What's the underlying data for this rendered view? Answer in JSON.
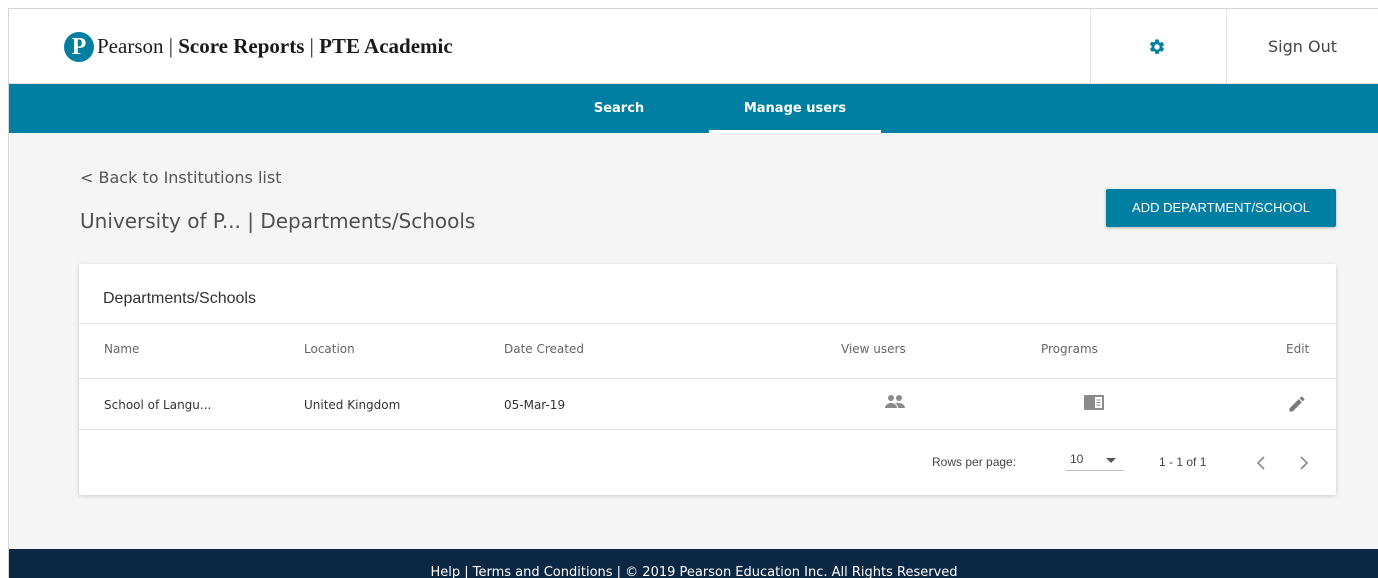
{
  "header": {
    "brand_parts": [
      "Pearson",
      "Score Reports",
      "PTE Academic"
    ],
    "settings_icon": "gear-icon",
    "sign_out": "Sign Out"
  },
  "nav": {
    "items": [
      {
        "label": "Search",
        "active": false
      },
      {
        "label": "Manage users",
        "active": true
      }
    ]
  },
  "page": {
    "back_link": "< Back to Institutions list",
    "title": "University of P... | Departments/Schools",
    "add_button": "ADD DEPARTMENT/SCHOOL"
  },
  "table": {
    "title": "Departments/Schools",
    "columns": [
      "Name",
      "Location",
      "Date Created",
      "View users",
      "Programs",
      "Edit"
    ],
    "rows": [
      {
        "name": "School of Langu...",
        "location": "United Kingdom",
        "date_created": "05-Mar-19",
        "view_users_icon": "people-icon",
        "programs_icon": "programs-icon",
        "edit_icon": "pencil-icon"
      }
    ],
    "pagination": {
      "rows_per_page_label": "Rows per page:",
      "rows_per_page_value": "10",
      "range": "1 - 1 of 1",
      "prev_icon": "chevron-left-icon",
      "next_icon": "chevron-right-icon"
    }
  },
  "footer": {
    "text": "Help | Terms and Conditions | © 2019 Pearson Education Inc. All Rights Reserved"
  },
  "colors": {
    "brand_blue": "#007fa3",
    "footer_navy": "#0c2744",
    "background": "#f5f5f5"
  }
}
